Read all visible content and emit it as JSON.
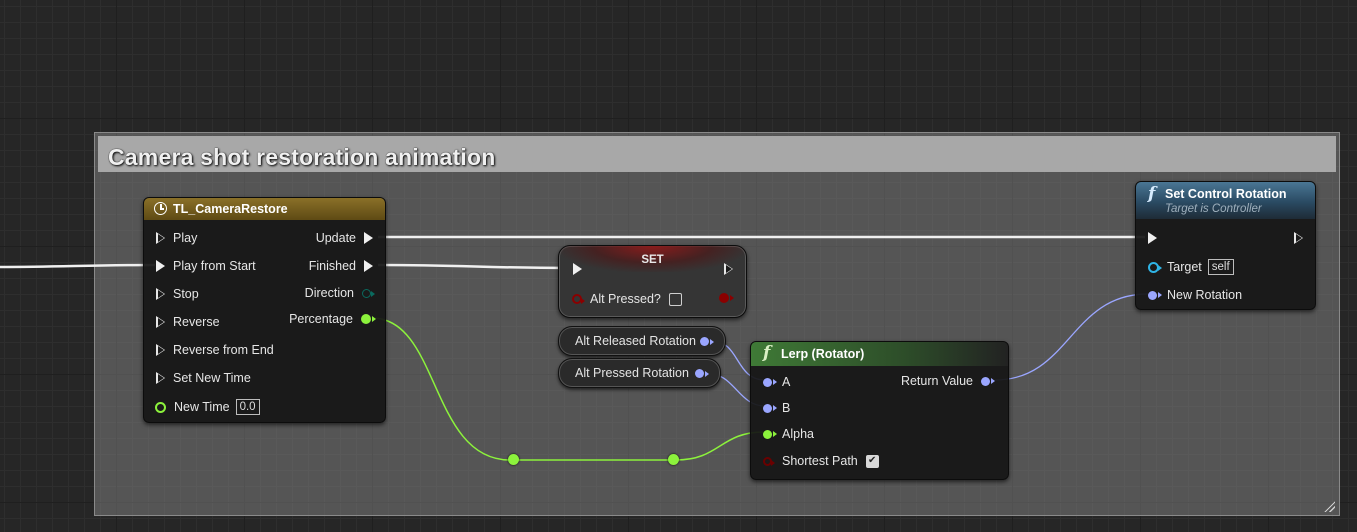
{
  "comment": {
    "title": "Camera shot restoration animation"
  },
  "timeline_node": {
    "title": "TL_CameraRestore",
    "inputs": [
      "Play",
      "Play from Start",
      "Stop",
      "Reverse",
      "Reverse from End",
      "Set New Time"
    ],
    "new_time_label": "New Time",
    "new_time_value": "0.0",
    "outputs": [
      "Update",
      "Finished",
      "Direction",
      "Percentage"
    ],
    "icon": "clock-icon"
  },
  "set_node": {
    "title": "SET",
    "pin_label": "Alt Pressed?",
    "checked": false
  },
  "var_nodes": [
    "Alt Released Rotation",
    "Alt Pressed Rotation"
  ],
  "lerp_node": {
    "title": "Lerp (Rotator)",
    "inputs": [
      "A",
      "B",
      "Alpha",
      "Shortest Path"
    ],
    "output": "Return Value",
    "shortest_path_checked": true,
    "icon": "function-icon"
  },
  "set_rotation_node": {
    "title": "Set Control Rotation",
    "subtitle": "Target is Controller",
    "target_label": "Target",
    "target_value": "self",
    "new_rotation_label": "New Rotation",
    "icon": "function-icon"
  },
  "colors": {
    "exec": "#f0f0f0",
    "float_pin": "#8cf23c",
    "rotator_pin": "#9aa6ff",
    "bool_pin": "#8a0000",
    "object_pin": "#2fb4e6",
    "timeline_header": "#6e5a1c",
    "function_header_green": "#3a6a34",
    "function_header_blue": "#2c4e6a"
  }
}
